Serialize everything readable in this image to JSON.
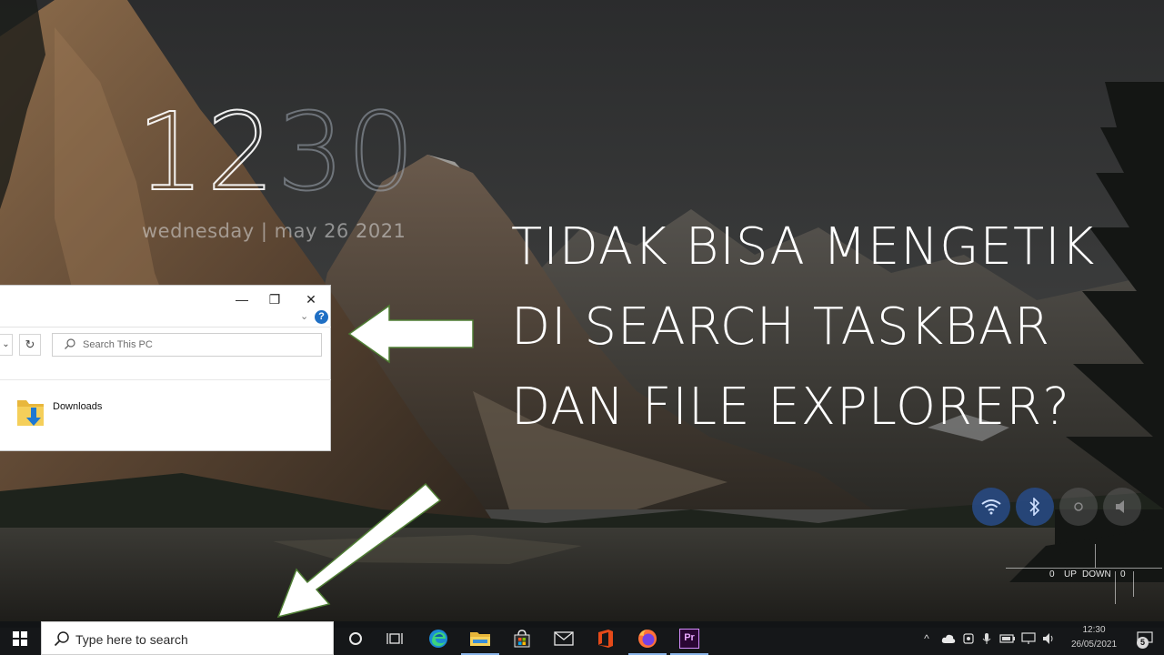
{
  "clock": {
    "hours": "12",
    "minutes": "30",
    "date": "wednesday | may 26 2021"
  },
  "headline": {
    "line1": "TIDAK BISA MENGETIK",
    "line2": "DI SEARCH TASKBAR",
    "line3": "DAN FILE EXPLORER?"
  },
  "explorer": {
    "minimize": "—",
    "restore": "❐",
    "close": "✕",
    "ribbon_toggle": "⌄",
    "help": "?",
    "nav_dropdown": "⌄",
    "refresh": "↻",
    "search_placeholder": "Search This PC",
    "items": [
      {
        "label": "Downloads",
        "icon": "downloads-folder-icon"
      }
    ]
  },
  "quick_actions": [
    {
      "name": "wifi",
      "state": "on"
    },
    {
      "name": "bluetooth",
      "state": "on"
    },
    {
      "name": "brightness",
      "state": "off"
    },
    {
      "name": "volume",
      "state": "off"
    }
  ],
  "net_meter": {
    "up_value": "0",
    "up_label": "UP",
    "down_label": "DOWN",
    "down_value": "0"
  },
  "taskbar": {
    "search_placeholder": "Type here to search",
    "pinned": [
      {
        "name": "cortana",
        "icon": "cortana-circle-icon"
      },
      {
        "name": "task-view",
        "icon": "task-view-icon"
      },
      {
        "name": "edge",
        "icon": "edge-icon"
      },
      {
        "name": "file-explorer",
        "icon": "folder-icon"
      },
      {
        "name": "store",
        "icon": "store-bag-icon"
      },
      {
        "name": "mail",
        "icon": "mail-icon"
      },
      {
        "name": "office",
        "icon": "office-icon"
      },
      {
        "name": "firefox",
        "icon": "firefox-icon"
      },
      {
        "name": "premiere-pro",
        "icon": "premiere-pro-icon",
        "label": "Pr"
      }
    ],
    "tray": {
      "chevron": "^",
      "time": "12:30",
      "date": "26/05/2021",
      "notification_count": "5"
    }
  },
  "colors": {
    "accent_blue": "#1f6fc4",
    "taskbar_bg": "#121416",
    "quick_action_on": "#284b87",
    "arrow_fill": "#ffffff",
    "arrow_stroke": "#5a8a3a"
  }
}
